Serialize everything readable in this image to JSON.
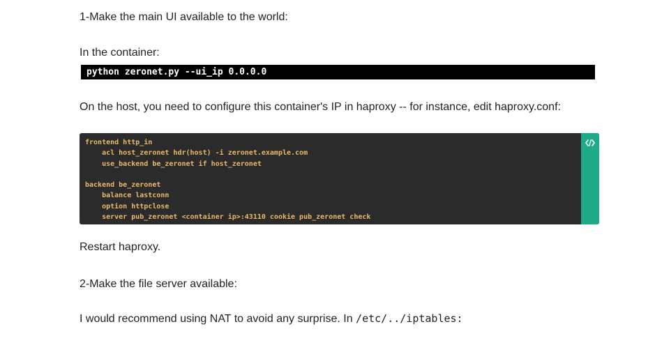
{
  "paragraphs": {
    "step1": "1-Make the main UI available to the world:",
    "in_container": "In the container:",
    "host_config": "On the host, you need to configure this container's IP in haproxy -- for instance, edit haproxy.conf:",
    "restart": "Restart haproxy.",
    "step2": "2-Make the file server available:",
    "nat_text": "I would recommend using NAT to avoid any surprise. In ",
    "nat_path": "/etc/../iptables:"
  },
  "command": "python zeronet.py --ui_ip 0.0.0.0",
  "code_block": {
    "lines": [
      "frontend http_in",
      "    acl host_zeronet hdr(host) -i zeronet.example.com",
      "    use_backend be_zeronet if host_zeronet",
      "",
      "backend be_zeronet",
      "    balance lastconn",
      "    option httpclose",
      "    server pub_zeronet <container ip>:43110 cookie pub_zeronet check"
    ],
    "copy_icon": "code-icon"
  },
  "colors": {
    "code_bg": "#2b2b2b",
    "code_text": "#e8b96a",
    "accent_tab": "#1fab8a",
    "command_bg": "#000000"
  }
}
